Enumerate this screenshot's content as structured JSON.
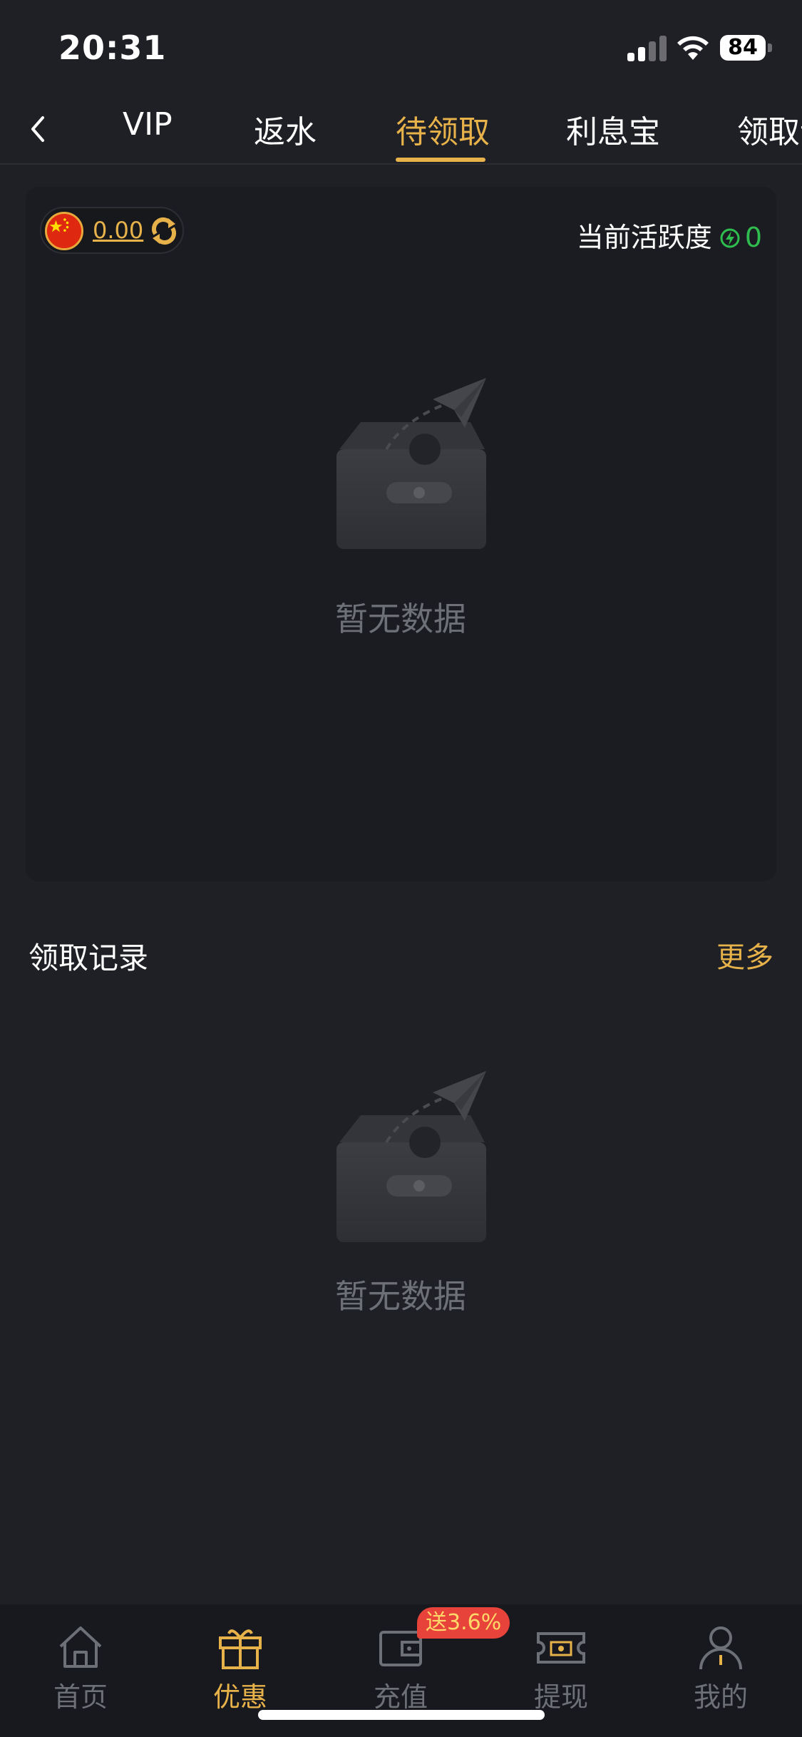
{
  "status_bar": {
    "time": "20:31",
    "battery": "84"
  },
  "tabs": [
    {
      "label": "VIP"
    },
    {
      "label": "返水"
    },
    {
      "label": "待领取"
    },
    {
      "label": "利息宝"
    },
    {
      "label": "领取记"
    }
  ],
  "active_tab": "待领取",
  "balance": {
    "value": "0.00",
    "currency_icon": "china-flag-icon"
  },
  "activity": {
    "label": "当前活跃度",
    "value": "0"
  },
  "pending_empty": {
    "text": "暂无数据"
  },
  "records": {
    "title": "领取记录",
    "more": "更多",
    "empty_text": "暂无数据"
  },
  "bottom_nav": {
    "items": [
      {
        "label": "首页",
        "icon": "home-icon"
      },
      {
        "label": "优惠",
        "icon": "gift-icon"
      },
      {
        "label": "充值",
        "icon": "wallet-icon"
      },
      {
        "label": "提现",
        "icon": "withdraw-icon"
      },
      {
        "label": "我的",
        "icon": "profile-icon"
      }
    ],
    "active": "优惠",
    "promo_badge": "送3.6%"
  },
  "colors": {
    "accent": "#e7b24a",
    "background": "#1f2026",
    "activity_green": "#2ebd4e",
    "badge_red": "#e8433a"
  }
}
